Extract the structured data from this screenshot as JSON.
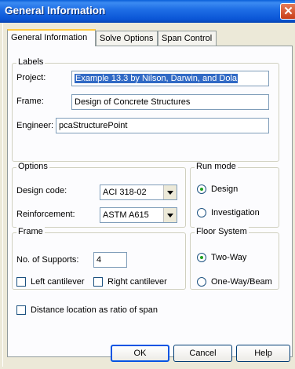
{
  "window": {
    "title": "General Information",
    "close_glyph": "✕"
  },
  "tabs": [
    {
      "label": "General Information",
      "active": true
    },
    {
      "label": "Solve Options",
      "active": false
    },
    {
      "label": "Span Control",
      "active": false
    }
  ],
  "labels_group": {
    "legend": "Labels",
    "project_label": "Project:",
    "project_value": "Example 13.3 by Nilson, Darwin, and Dola",
    "frame_label": "Frame:",
    "frame_value": "Design of Concrete Structures",
    "engineer_label": "Engineer:",
    "engineer_value": "pcaStructurePoint"
  },
  "options_group": {
    "legend": "Options",
    "design_code_label": "Design code:",
    "design_code_value": "ACI 318-02",
    "reinforcement_label": "Reinforcement:",
    "reinforcement_value": "ASTM A615"
  },
  "run_mode": {
    "legend": "Run mode",
    "design_label": "Design",
    "investigation_label": "Investigation",
    "selected": "Design"
  },
  "frame_group": {
    "legend": "Frame",
    "supports_label": "No. of Supports:",
    "supports_value": "4",
    "left_cantilever_label": "Left cantilever",
    "right_cantilever_label": "Right cantilever"
  },
  "floor_system": {
    "legend": "Floor System",
    "two_way_label": "Two-Way",
    "one_way_label": "One-Way/Beam",
    "selected": "Two-Way"
  },
  "distance_ratio_label": "Distance location as ratio of span",
  "buttons": {
    "ok": "OK",
    "cancel": "Cancel",
    "help": "Help"
  },
  "colors": {
    "title_bar": "#0a55d6",
    "dialog_bg": "#ece9d8",
    "selection": "#316ac5",
    "radio_dot": "#21a121"
  }
}
